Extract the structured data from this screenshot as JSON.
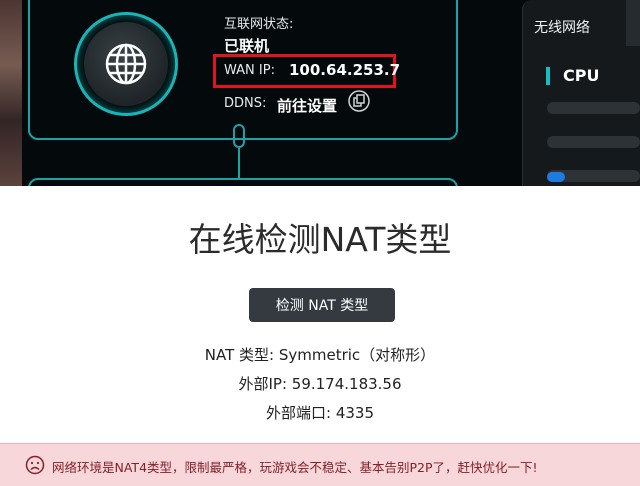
{
  "router_status": {
    "internet_status_label": "互联网状态:",
    "internet_status_value": "已联机",
    "wan_ip_label": "WAN IP:",
    "wan_ip_value": "100.64.253.7",
    "ddns_label": "DDNS:",
    "ddns_value": "前往设置"
  },
  "side_panel": {
    "tab_label": "无线网络",
    "cpu_label": "CPU"
  },
  "nat": {
    "title": "在线检测NAT类型",
    "detect_button": "检测 NAT 类型",
    "nat_type": "NAT 类型: Symmetric（对称形）",
    "external_ip": "外部IP: 59.174.183.56",
    "external_port": "外部端口: 4335"
  },
  "alert": {
    "icon": "frown-icon",
    "text": "网络环境是NAT4类型，限制最严格，玩游戏会不稳定、基本告别P2P了，赶快优化一下!",
    "background": "#f8d7da",
    "text_color": "#842029"
  },
  "colors": {
    "accent_teal": "#1aa3a6",
    "highlight_red": "#e0141a",
    "button_dark": "#343a40"
  }
}
